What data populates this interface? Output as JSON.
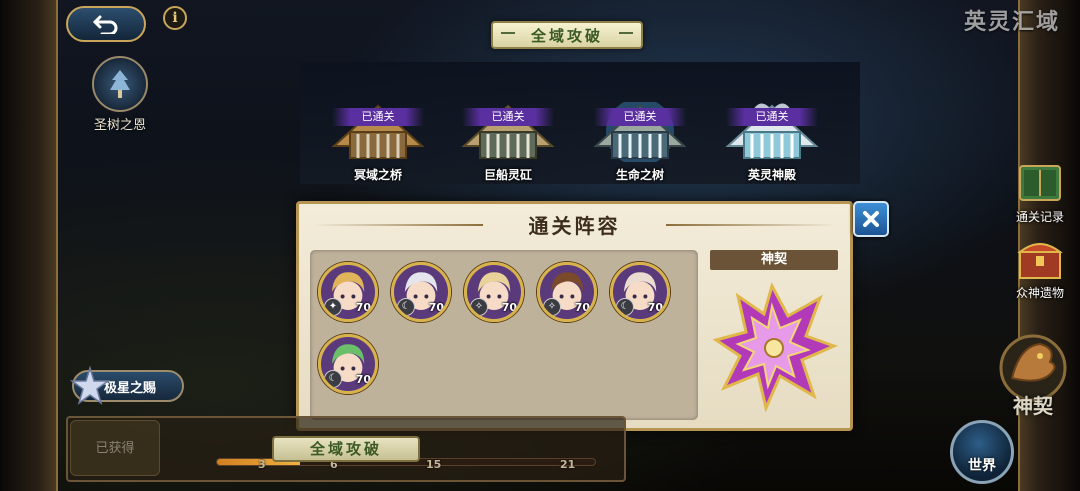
{
  "top": {
    "back_icon": "return-arrow-icon",
    "info_label": "i",
    "blessing_label": "圣树之恩",
    "corner_title": "英灵汇域"
  },
  "banner": {
    "title": "全域攻破"
  },
  "stages": [
    {
      "status": "已通关",
      "name": "冥域之桥"
    },
    {
      "status": "已通关",
      "name": "巨船灵矼"
    },
    {
      "status": "已通关",
      "name": "生命之树"
    },
    {
      "status": "已通关",
      "name": "英灵神殿"
    }
  ],
  "dialog": {
    "title": "通关阵容",
    "close_icon": "close-icon",
    "contract_title": "神契",
    "heroes": [
      {
        "level": "70",
        "hair": "#e2b45a",
        "elem": "wind"
      },
      {
        "level": "70",
        "hair": "#e4e4ec",
        "elem": "moon"
      },
      {
        "level": "70",
        "hair": "#e9d29a",
        "elem": "star"
      },
      {
        "level": "70",
        "hair": "#7a4a2c",
        "elem": "star"
      },
      {
        "level": "70",
        "hair": "#eadcd0",
        "elem": "moon"
      },
      {
        "level": "70",
        "hair": "#6cbf6a",
        "elem": "moon"
      }
    ]
  },
  "side": {
    "records": "通关记录",
    "relics": "众神遗物",
    "contract": "神契",
    "world": "世界"
  },
  "bottom": {
    "star_gift": "极星之赐",
    "obtained": "已获得",
    "banner": "全域攻破",
    "progress": 0.22,
    "milestones": [
      "3",
      "6",
      "15",
      "21"
    ]
  },
  "colors": {
    "gold": "#c9a65a",
    "status_purple": "#5a2fa0",
    "close_blue": "#3d8fd6",
    "panel": "#e6dcc2"
  }
}
